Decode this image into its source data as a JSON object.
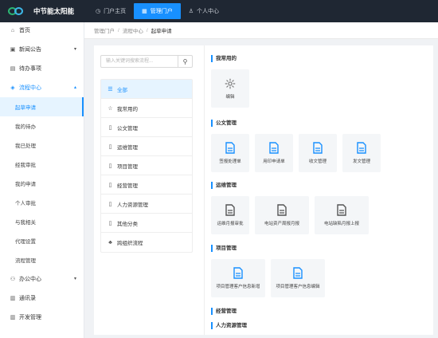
{
  "header": {
    "app_name": "中节能太阳能",
    "tabs": [
      {
        "icon": "clock-icon",
        "label": "门户主页"
      },
      {
        "icon": "grid-icon",
        "label": "管理门户"
      },
      {
        "icon": "user-icon",
        "label": "个人中心"
      }
    ],
    "active_tab": 1,
    "accent_color": "#1890ff",
    "topbar_color": "#1f2733"
  },
  "sidebar": {
    "items": [
      {
        "icon": "home-icon",
        "label": "首页"
      },
      {
        "icon": "news-icon",
        "label": "新闻公告"
      },
      {
        "icon": "task-icon",
        "label": "待办事项"
      },
      {
        "icon": "process-icon",
        "label": "流程中心"
      },
      {
        "icon": "office-icon",
        "label": "办公中心"
      },
      {
        "icon": "contacts-icon",
        "label": "通讯录"
      },
      {
        "icon": "dev-icon",
        "label": "开发管理"
      }
    ],
    "process_children": [
      "起草申请",
      "我的待办",
      "我已处理",
      "经我审批",
      "我的申请",
      "个人审批",
      "与我相关",
      "代理设置",
      "流程管理"
    ]
  },
  "breadcrumb": [
    "管理门户",
    "流程中心",
    "起草申请"
  ],
  "search": {
    "placeholder": "输入关键词搜索流程..."
  },
  "categories": [
    {
      "icon": "list-icon",
      "label": "全部"
    },
    {
      "icon": "star-icon",
      "label": "我常用的"
    },
    {
      "icon": "doc-icon",
      "label": "公文管理"
    },
    {
      "icon": "doc-icon",
      "label": "运维管理"
    },
    {
      "icon": "doc-icon",
      "label": "项目管理"
    },
    {
      "icon": "doc-icon",
      "label": "经营管理"
    },
    {
      "icon": "doc-icon",
      "label": "人力资源管理"
    },
    {
      "icon": "doc-icon",
      "label": "其他分类"
    },
    {
      "icon": "tree-icon",
      "label": "跨组织流程"
    }
  ],
  "sections": {
    "favorites": {
      "title": "我常用的",
      "tiles": [
        "编辑"
      ]
    },
    "documents": {
      "title": "公文管理",
      "tiles": [
        "签报处理单",
        "用印申请单",
        "收文管理",
        "发文管理"
      ]
    },
    "operations": {
      "title": "运维管理",
      "tiles": [
        "运维月报审批",
        "电站资产周报月报",
        "电站缺陷月报上报"
      ]
    },
    "projects": {
      "title": "项目管理",
      "tiles": [
        "项目管理客户信息新增",
        "项目管理客户信息编辑"
      ]
    },
    "business": {
      "title": "经营管理"
    },
    "hr": {
      "title": "人力资源管理"
    }
  }
}
